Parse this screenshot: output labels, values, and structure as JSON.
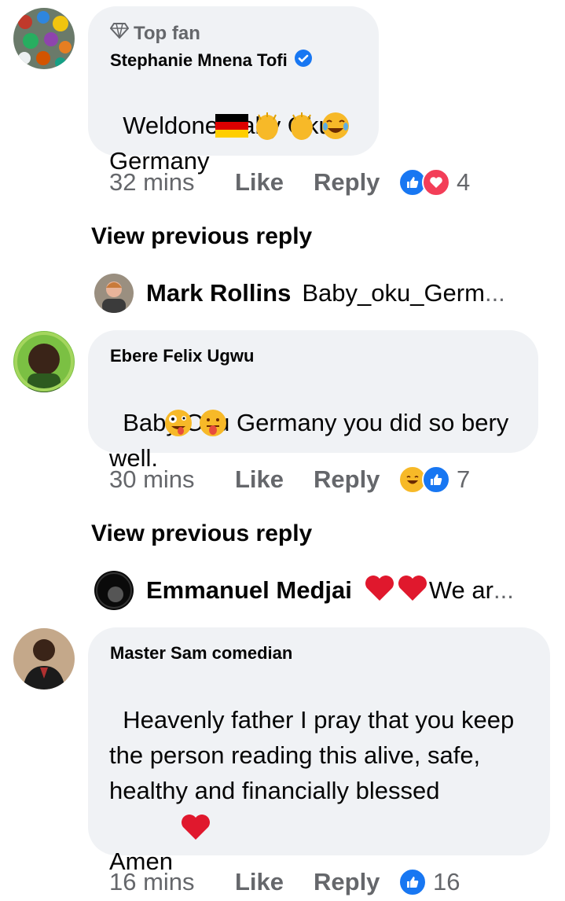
{
  "comments": [
    {
      "badge": "Top fan",
      "author": "Stephanie Mnena Tofi",
      "verified": true,
      "text": "Weldone Baby Oku\nGermany",
      "time": "32 mins",
      "like_label": "Like",
      "reply_label": "Reply",
      "reaction_icons": [
        "like-icon",
        "love-icon"
      ],
      "reaction_count": "4"
    },
    {
      "author": "Ebere Felix Ugwu",
      "text": "Baby Oku Germany you did so bery\nwell.",
      "time": "30 mins",
      "like_label": "Like",
      "reply_label": "Reply",
      "reaction_icons": [
        "haha-icon",
        "like-icon"
      ],
      "reaction_count": "7"
    },
    {
      "author": "Master Sam comedian",
      "text": "Heavenly father I pray that you keep\nthe person reading this alive, safe,\nhealthy and financially blessed\n\nAmen",
      "time": "16 mins",
      "like_label": "Like",
      "reply_label": "Reply",
      "reaction_icons": [
        "like-icon"
      ],
      "reaction_count": "16"
    }
  ],
  "reply_previews": [
    {
      "view_previous": "View previous reply",
      "name": "Mark Rollins",
      "text": "Baby_oku_Germ",
      "ellipsis": "..."
    },
    {
      "view_previous": "View previous reply",
      "name": "Emmanuel Medjai",
      "text": "We ar",
      "ellipsis": "..."
    }
  ],
  "colors": {
    "bubble": "#f0f2f5",
    "secondary_text": "#65676b",
    "like_blue": "#1877f2",
    "love_red": "#f33e58",
    "haha_yellow": "#f7b928"
  }
}
